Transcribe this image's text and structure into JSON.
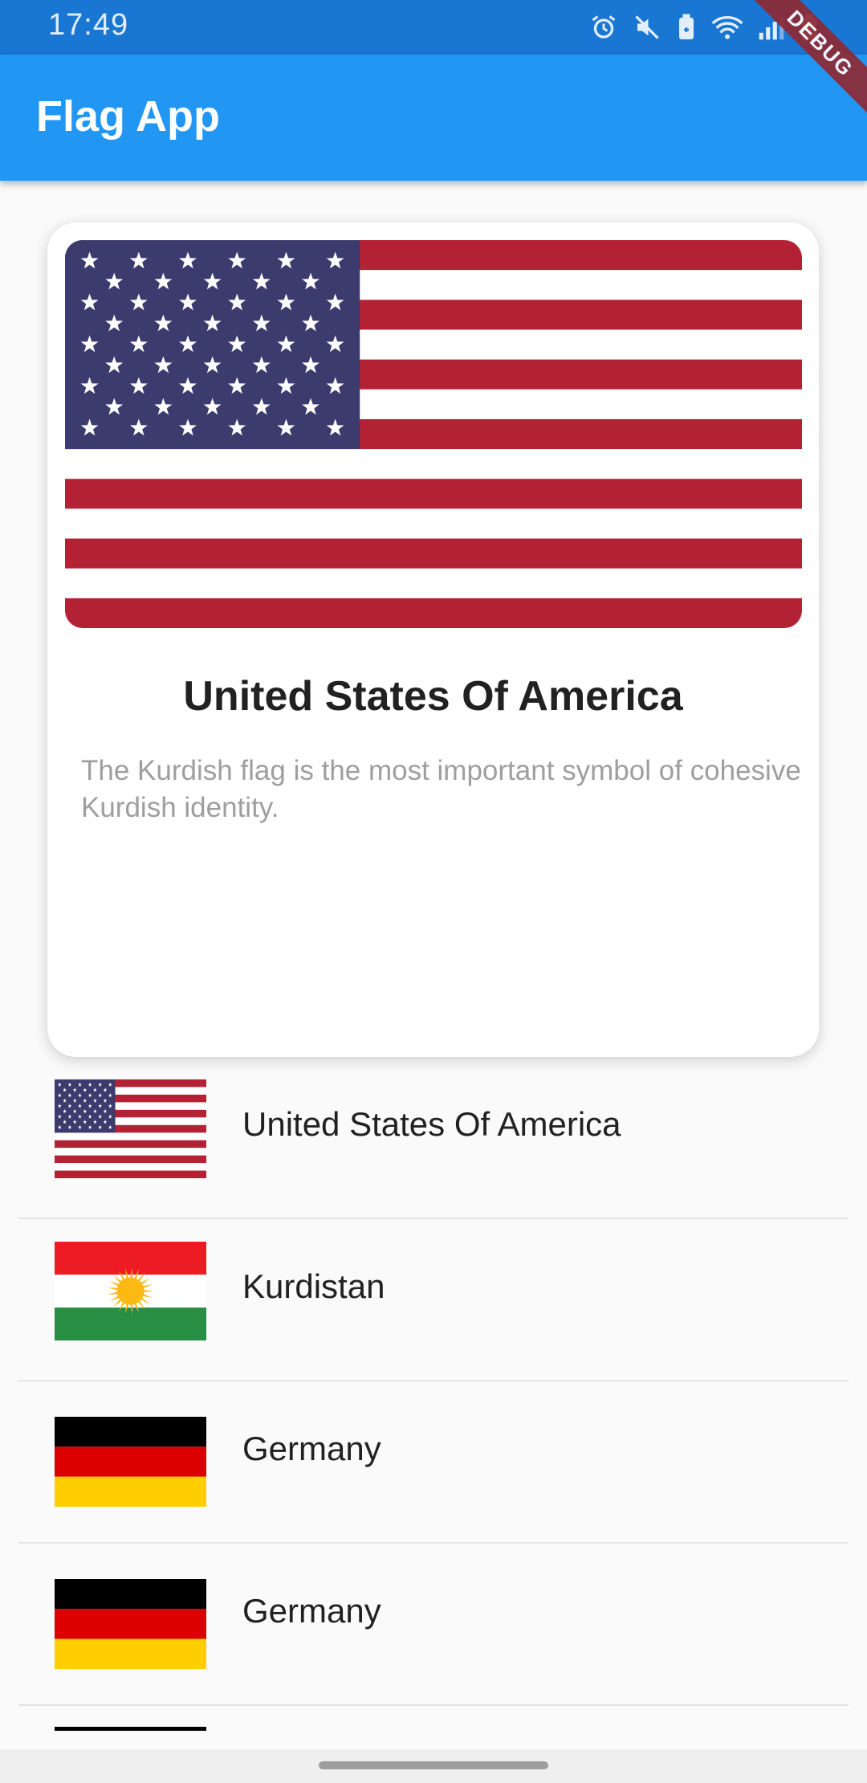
{
  "status_bar": {
    "time": "17:49",
    "icons": [
      "alarm-icon",
      "mute-icon",
      "battery-saver-icon",
      "wifi-icon",
      "signal-icon",
      "battery-icon"
    ]
  },
  "app_bar": {
    "title": "Flag App"
  },
  "debug_banner": {
    "label": "DEBUG"
  },
  "detail_card": {
    "flag": "usa",
    "title": "United States Of America",
    "description": "The Kurdish flag is the most important symbol of cohesive Kurdish identity."
  },
  "countries": [
    {
      "name": "United States Of America",
      "flag": "usa"
    },
    {
      "name": "Kurdistan",
      "flag": "kurdistan"
    },
    {
      "name": "Germany",
      "flag": "germany"
    },
    {
      "name": "Germany",
      "flag": "germany"
    }
  ],
  "colors": {
    "status_bar": "#1976d2",
    "app_bar": "#2196f3",
    "usa_red": "#b22234",
    "usa_blue": "#3c3b6e",
    "kurd_red": "#ed1c24",
    "kurd_green": "#278e43",
    "kurd_sun": "#fdb913",
    "de_black": "#000000",
    "de_red": "#dd0000",
    "de_gold": "#ffce00"
  }
}
